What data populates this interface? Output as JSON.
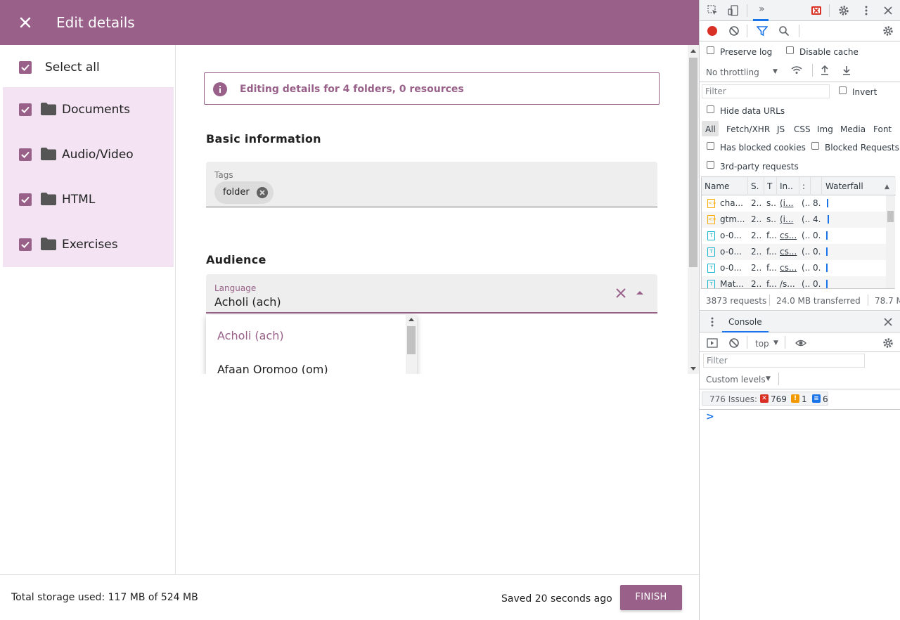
{
  "app": {
    "title": "Edit details",
    "select_all_label": "Select all",
    "folders": [
      {
        "label": "Documents"
      },
      {
        "label": "Audio/Video"
      },
      {
        "label": "HTML"
      },
      {
        "label": "Exercises"
      }
    ],
    "banner_text": "Editing details for 4 folders, 0 resources",
    "basic_title": "Basic information",
    "tags_label": "Tags",
    "tags": [
      "folder"
    ],
    "audience_title": "Audience",
    "language_label": "Language",
    "language_value": "Acholi (ach)",
    "language_options": [
      "Acholi (ach)",
      "Afaan Oromoo (om)"
    ],
    "storage_text": "Total storage used: 117 MB of 524 MB",
    "saved_text": "Saved 20 seconds ago",
    "finish_label": "FINISH",
    "colors": {
      "brand": "#996189",
      "folder_bg": "#f3e3f3",
      "field_bg": "#eeeeee"
    }
  },
  "devtools": {
    "preserve_log": "Preserve log",
    "disable_cache": "Disable cache",
    "throttling": "No throttling",
    "filter_placeholder": "Filter",
    "invert": "Invert",
    "hide_data_urls": "Hide data URLs",
    "type_filters": [
      "All",
      "Fetch/XHR",
      "JS",
      "CSS",
      "Img",
      "Media",
      "Font"
    ],
    "has_blocked_cookies": "Has blocked cookies",
    "blocked_requests": "Blocked Requests",
    "third_party": "3rd-party requests",
    "columns": [
      "Name",
      "S.",
      "T",
      "In..",
      ":",
      "",
      "Waterfall"
    ],
    "rows": [
      {
        "icon": "JS",
        "name": "cha...",
        "s": "2...",
        "t": "s...",
        "in": "(i...",
        "x": "(...",
        "size": "8."
      },
      {
        "icon": "JS",
        "name": "gtm...",
        "s": "2...",
        "t": "s...",
        "in": "(i...",
        "x": "(...",
        "size": "4."
      },
      {
        "icon": "T",
        "name": "o-0...",
        "s": "2...",
        "t": "f...",
        "in": "cs...",
        "x": "(...",
        "size": "0."
      },
      {
        "icon": "T",
        "name": "o-0...",
        "s": "2...",
        "t": "f...",
        "in": "cs...",
        "x": "(...",
        "size": "0."
      },
      {
        "icon": "T",
        "name": "o-0...",
        "s": "2...",
        "t": "f...",
        "in": "cs...",
        "x": "(...",
        "size": "0."
      },
      {
        "icon": "T",
        "name": "Mat...",
        "s": "2...",
        "t": "f...",
        "in": "/s...",
        "x": "(...",
        "size": "0."
      }
    ],
    "requests": "3873 requests",
    "transferred": "24.0 MB transferred",
    "resources": "78.7 M",
    "console_tab": "Console",
    "context": "top",
    "console_filter_placeholder": "Filter",
    "levels": "Custom levels",
    "issues_label": "776 Issues:",
    "issues_errors": "769",
    "issues_warnings": "1",
    "issues_info": "6",
    "prompt": ">"
  }
}
